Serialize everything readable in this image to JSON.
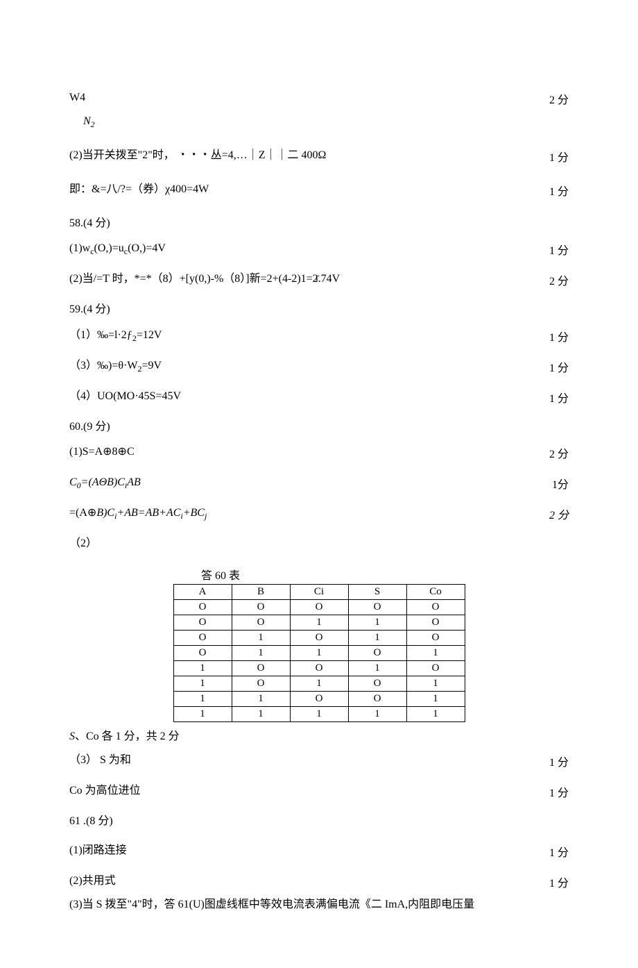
{
  "l1": {
    "text": "W4",
    "pts": "2 分"
  },
  "l1b": "N",
  "l1b_sub": "2",
  "l2": {
    "text": "(2)当开关拨至\"2\"时， ・・・丛=4,…｜Z｜｜二 400Ω",
    "pts": "1 分"
  },
  "l3": {
    "text": "即：&=八/?=（券）χ400=4W",
    "pts": "1 分"
  },
  "l4": "58.(4 分)",
  "l5": {
    "text": "(1)w",
    "sub1": "c",
    "mid": "(O,)=u",
    "sub2": "c",
    "end": "(O,)=4V",
    "pts": "1 分"
  },
  "l6r": "r",
  "l6": {
    "text": "(2)当/=T 时，*=*（8）+[y(0,)-%（8）]新=2+(4-2)1=2.74V",
    "pts": "2 分"
  },
  "l7": "59.(4 分)",
  "l8": {
    "text": "（1）‰=l·2ƒ",
    "sub": "2",
    "end": "=12V",
    "pts": "1 分"
  },
  "l9": {
    "text": "（3）‰)=θ·W",
    "sub": "2",
    "end": "=9V",
    "pts": "1 分"
  },
  "l10": {
    "text": "（4）UO(MO·45S=45V",
    "pts": "1 分"
  },
  "l11": "60.(9 分)",
  "l12": {
    "text": "(1)S=A⊕8⊕C",
    "pts": "2 分"
  },
  "l13": {
    "c0": "C",
    "c0sub": "0",
    "mid": "=(AΘB)C",
    "midsub": "i",
    "ab": "AB",
    "pts": "1分"
  },
  "l14": {
    "pre": "=(A⊕",
    "b": "B)C",
    "bsub": "i",
    "mid": "+AB=AB+AC",
    "midsub": "i",
    "end": "+BC",
    "endsub": "j",
    "pts": "2 分"
  },
  "l15": "（2）",
  "tcap": "答 60 表",
  "table": [
    [
      "A",
      "B",
      "Ci",
      "S",
      "Co"
    ],
    [
      "O",
      "O",
      "O",
      "O",
      "O"
    ],
    [
      "O",
      "O",
      "1",
      "1",
      "O"
    ],
    [
      "O",
      "1",
      "O",
      "1",
      "O"
    ],
    [
      "O",
      "1",
      "1",
      "O",
      "1"
    ],
    [
      "1",
      "O",
      "O",
      "1",
      "O"
    ],
    [
      "1",
      "O",
      "1",
      "O",
      "1"
    ],
    [
      "1",
      "1",
      "O",
      "O",
      "1"
    ],
    [
      "1",
      "1",
      "1",
      "1",
      "1"
    ]
  ],
  "sc": {
    "s": "S",
    "rest": "、Co 各 1 分，共 2 分"
  },
  "l16": {
    "text": "（3） S 为和",
    "pts": "1 分"
  },
  "l17": {
    "text": "Co 为高位进位",
    "pts": "1 分"
  },
  "l18": "61  .(8 分)",
  "l19": {
    "text": "(1)闭路连接",
    "pts": "1 分"
  },
  "l20": {
    "text": "(2)共用式",
    "pts": "1  分"
  },
  "l21": "(3)当 S 拨至\"4\"时，答 61(U)图虚线框中等效电流表满偏电流《二 ImA,内阻即电压量"
}
